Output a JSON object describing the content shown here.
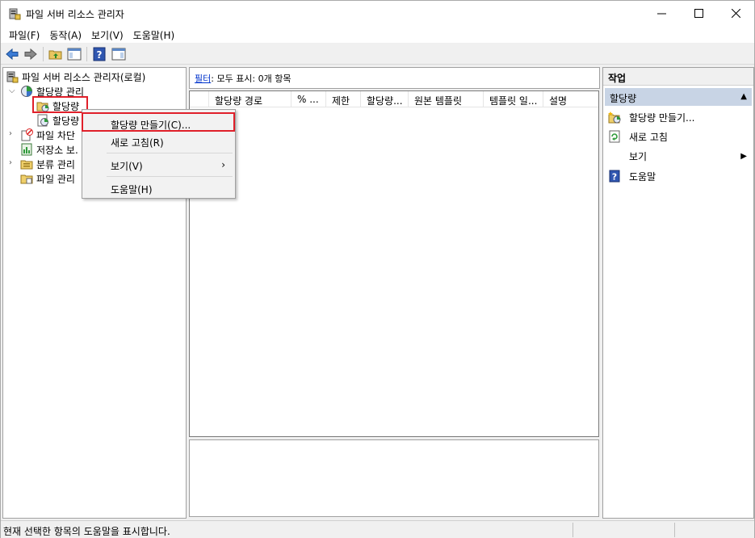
{
  "window": {
    "title": "파일 서버 리소스 관리자",
    "minimize": "—",
    "maximize": "☐",
    "close": "✕"
  },
  "menu": [
    "파일(F)",
    "동작(A)",
    "보기(V)",
    "도움말(H)"
  ],
  "tree": {
    "root": "파일 서버 리소스 관리자(로컬)",
    "quota_mgmt": "할당량 관리",
    "quotas": "할당량",
    "quota_templates": "할당량",
    "file_screening": "파일 차단",
    "storage_reports": "저장소 보.",
    "classification": "분류 관리",
    "file_mgmt": "파일 관리"
  },
  "filter": {
    "link": "필터",
    "text": ": 모두 표시: 0개 항목"
  },
  "columns": [
    "할당량 경로",
    "% ...",
    "제한",
    "할당량...",
    "원본 템플릿",
    "템플릿 일...",
    "설명"
  ],
  "actions": {
    "header": "작업",
    "section": "할당량",
    "items": [
      "할당량 만들기...",
      "새로 고침",
      "보기",
      "도움말"
    ]
  },
  "context_menu": {
    "items": [
      "할당량 만들기(C)...",
      "새로 고침(R)",
      "보기(V)",
      "도움말(H)"
    ]
  },
  "status": {
    "text": "현재 선택한 항목의 도움말을 표시합니다."
  },
  "colors": {
    "highlight_red": "#e0202a",
    "section_bg": "#c8d4e5",
    "link_blue": "#0033cc"
  }
}
